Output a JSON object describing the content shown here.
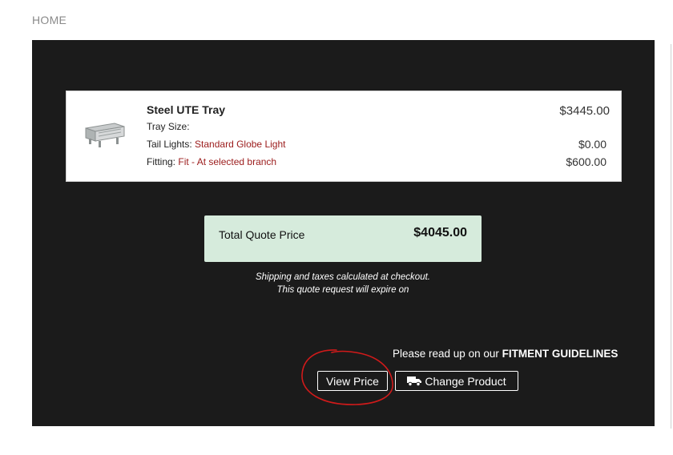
{
  "breadcrumb": {
    "home": "HOME"
  },
  "cart": {
    "product_name": "Steel UTE Tray",
    "product_price": "$3445.00",
    "options": [
      {
        "label": "Tray Size:",
        "value": "",
        "price": ""
      },
      {
        "label": "Tail Lights:",
        "value": "Standard Globe Light",
        "price": "$0.00"
      },
      {
        "label": "Fitting:",
        "value": "Fit - At selected branch",
        "price": "$600.00"
      }
    ]
  },
  "total": {
    "label": "Total Quote Price",
    "value": "$4045.00"
  },
  "notes": {
    "shipping": "Shipping and taxes calculated at checkout.",
    "expiry": "This quote request will expire on"
  },
  "fitment": {
    "prefix": "Please read up on our",
    "link": "FITMENT GUIDELINES"
  },
  "buttons": {
    "view_price": "View Price",
    "change_product": "Change Product"
  },
  "icons": {
    "thumbnail": "ute-tray-image",
    "truck": "truck-icon"
  },
  "colors": {
    "panel_bg": "#1b1b1b",
    "total_bg": "#d6ebdc",
    "option_value": "#9b1b1b",
    "annotation": "#d11a1a"
  }
}
